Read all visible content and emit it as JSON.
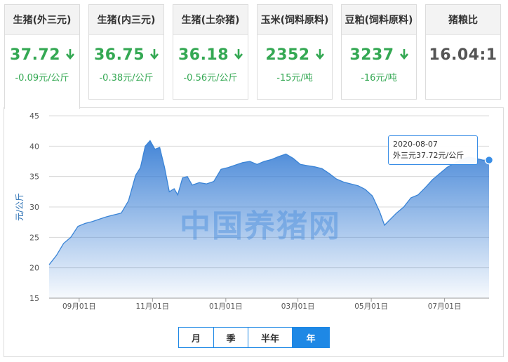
{
  "tabs": [
    {
      "title": "生猪(外三元)",
      "price": "37.72",
      "change": "-0.09元/公斤",
      "trend": "down"
    },
    {
      "title": "生猪(内三元)",
      "price": "36.75",
      "change": "-0.38元/公斤",
      "trend": "down"
    },
    {
      "title": "生猪(土杂猪)",
      "price": "36.18",
      "change": "-0.56元/公斤",
      "trend": "down"
    },
    {
      "title": "玉米(饲料原料)",
      "price": "2352",
      "change": "-15元/吨",
      "trend": "down"
    },
    {
      "title": "豆粕(饲料原料)",
      "price": "3237",
      "change": "-16元/吨",
      "trend": "down"
    },
    {
      "title": "猪粮比",
      "price": "16.04:1",
      "change": "",
      "trend": "none"
    }
  ],
  "active_tab": 0,
  "colors": {
    "down": "#34a853",
    "accent": "#1e88e5",
    "line": "#3a84d6"
  },
  "watermark": "中国养猪网",
  "tooltip": {
    "date": "2020-08-07",
    "value_text": "外三元37.72元/公斤"
  },
  "period_buttons": [
    "月",
    "季",
    "半年",
    "年"
  ],
  "active_period": "年",
  "chart_data": {
    "type": "area",
    "ylabel": "元/公斤",
    "ylim": [
      15,
      45
    ],
    "yticks": [
      15,
      20,
      25,
      30,
      35,
      40,
      45
    ],
    "xlim": [
      "2019-08-07",
      "2020-08-07"
    ],
    "xticks": [
      {
        "date": "2019-09-01",
        "label": "09月01日"
      },
      {
        "date": "2019-11-01",
        "label": "11月01日"
      },
      {
        "date": "2020-01-01",
        "label": "01月01日"
      },
      {
        "date": "2020-03-01",
        "label": "03月01日"
      },
      {
        "date": "2020-05-01",
        "label": "05月01日"
      },
      {
        "date": "2020-07-01",
        "label": "07月01日"
      }
    ],
    "grid": true,
    "series": [
      {
        "points": [
          [
            "2019-08-07",
            20.5
          ],
          [
            "2019-08-13",
            22.0
          ],
          [
            "2019-08-19",
            24.0
          ],
          [
            "2019-08-25",
            25.0
          ],
          [
            "2019-08-31",
            26.8
          ],
          [
            "2019-09-06",
            27.3
          ],
          [
            "2019-09-12",
            27.6
          ],
          [
            "2019-09-18",
            28.0
          ],
          [
            "2019-09-24",
            28.4
          ],
          [
            "2019-09-30",
            28.7
          ],
          [
            "2019-10-06",
            29.0
          ],
          [
            "2019-10-12",
            31.0
          ],
          [
            "2019-10-18",
            35.2
          ],
          [
            "2019-10-22",
            36.5
          ],
          [
            "2019-10-26",
            40.0
          ],
          [
            "2019-10-30",
            40.9
          ],
          [
            "2019-11-03",
            39.5
          ],
          [
            "2019-11-07",
            39.8
          ],
          [
            "2019-11-11",
            36.5
          ],
          [
            "2019-11-15",
            32.5
          ],
          [
            "2019-11-19",
            33.0
          ],
          [
            "2019-11-22",
            32.0
          ],
          [
            "2019-11-26",
            34.8
          ],
          [
            "2019-11-30",
            35.0
          ],
          [
            "2019-12-04",
            33.6
          ],
          [
            "2019-12-10",
            34.0
          ],
          [
            "2019-12-16",
            33.8
          ],
          [
            "2019-12-22",
            34.2
          ],
          [
            "2019-12-28",
            36.2
          ],
          [
            "2020-01-03",
            36.5
          ],
          [
            "2020-01-09",
            36.9
          ],
          [
            "2020-01-15",
            37.3
          ],
          [
            "2020-01-21",
            37.5
          ],
          [
            "2020-01-27",
            37.0
          ],
          [
            "2020-02-02",
            37.5
          ],
          [
            "2020-02-08",
            37.8
          ],
          [
            "2020-02-14",
            38.3
          ],
          [
            "2020-02-20",
            38.7
          ],
          [
            "2020-02-26",
            38.0
          ],
          [
            "2020-03-03",
            37.0
          ],
          [
            "2020-03-09",
            36.8
          ],
          [
            "2020-03-15",
            36.6
          ],
          [
            "2020-03-21",
            36.3
          ],
          [
            "2020-03-27",
            35.5
          ],
          [
            "2020-04-02",
            34.6
          ],
          [
            "2020-04-08",
            34.1
          ],
          [
            "2020-04-14",
            33.8
          ],
          [
            "2020-04-20",
            33.5
          ],
          [
            "2020-04-26",
            32.9
          ],
          [
            "2020-05-02",
            31.8
          ],
          [
            "2020-05-08",
            29.2
          ],
          [
            "2020-05-12",
            27.0
          ],
          [
            "2020-05-16",
            27.8
          ],
          [
            "2020-05-22",
            29.0
          ],
          [
            "2020-05-28",
            30.0
          ],
          [
            "2020-06-03",
            31.5
          ],
          [
            "2020-06-09",
            32.0
          ],
          [
            "2020-06-15",
            33.2
          ],
          [
            "2020-06-21",
            34.5
          ],
          [
            "2020-06-27",
            35.5
          ],
          [
            "2020-07-03",
            36.5
          ],
          [
            "2020-07-09",
            37.2
          ],
          [
            "2020-07-15",
            37.8
          ],
          [
            "2020-07-21",
            38.2
          ],
          [
            "2020-07-27",
            38.0
          ],
          [
            "2020-08-02",
            37.7
          ],
          [
            "2020-08-07",
            37.72
          ]
        ]
      }
    ]
  }
}
